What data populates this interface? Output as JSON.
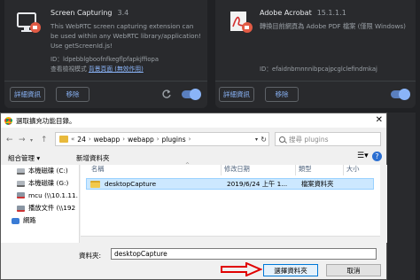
{
  "extensions": [
    {
      "name": "Screen Capturing",
      "version": "3.4",
      "description": "This WebRTC screen capturing extension can be used within any WebRTC library/application! Use getScreenId.js!",
      "id_text": "ID：ldpebblgboofnfkegflpfapkjffiopa",
      "view_label": "查看檢視模式",
      "view_link": "背景頁面 (無效作用)",
      "details_label": "詳細資訊",
      "remove_label": "移除"
    },
    {
      "name": "Adobe Acrobat",
      "version": "15.1.1.1",
      "description": "轉換目前網頁為 Adobe PDF 檔案 (僅限 Windows)",
      "id_text": "ID：efaidnbmnnnibpcajpcglclefindmkaj",
      "details_label": "詳細資訊",
      "remove_label": "移除"
    }
  ],
  "dialog": {
    "title": "選取擴充功能目錄。",
    "path": [
      "24",
      "webapp",
      "webapp",
      "plugins"
    ],
    "search_placeholder": "搜尋 plugins",
    "toolbar": {
      "organize": "組合管理 ▾",
      "new_folder": "新增資料夾"
    },
    "nav_items": [
      {
        "label": "本機磁碟 (C:)",
        "icon": "drive-icon"
      },
      {
        "label": "本機磁碟 (G:)",
        "icon": "drive-icon"
      },
      {
        "label": "mcu (\\\\10.1.11.",
        "icon": "network-drive-icon"
      },
      {
        "label": "播放文件 (\\\\192",
        "icon": "network-drive-icon"
      },
      {
        "label": "網路",
        "icon": "network-icon"
      }
    ],
    "columns": [
      "名稱",
      "修改日期",
      "類型",
      "大小"
    ],
    "files": [
      {
        "name": "desktopCapture",
        "date": "2019/6/24 上午 1...",
        "type": "檔案資料夾",
        "size": ""
      }
    ],
    "folder_label": "資料夾:",
    "folder_value": "desktopCapture",
    "select_button": "選擇資料夾",
    "cancel_button": "取消"
  },
  "colors": {
    "accent_dark": "#8ab4f8",
    "arrow": "#e00000",
    "selection": "#cce8ff"
  }
}
